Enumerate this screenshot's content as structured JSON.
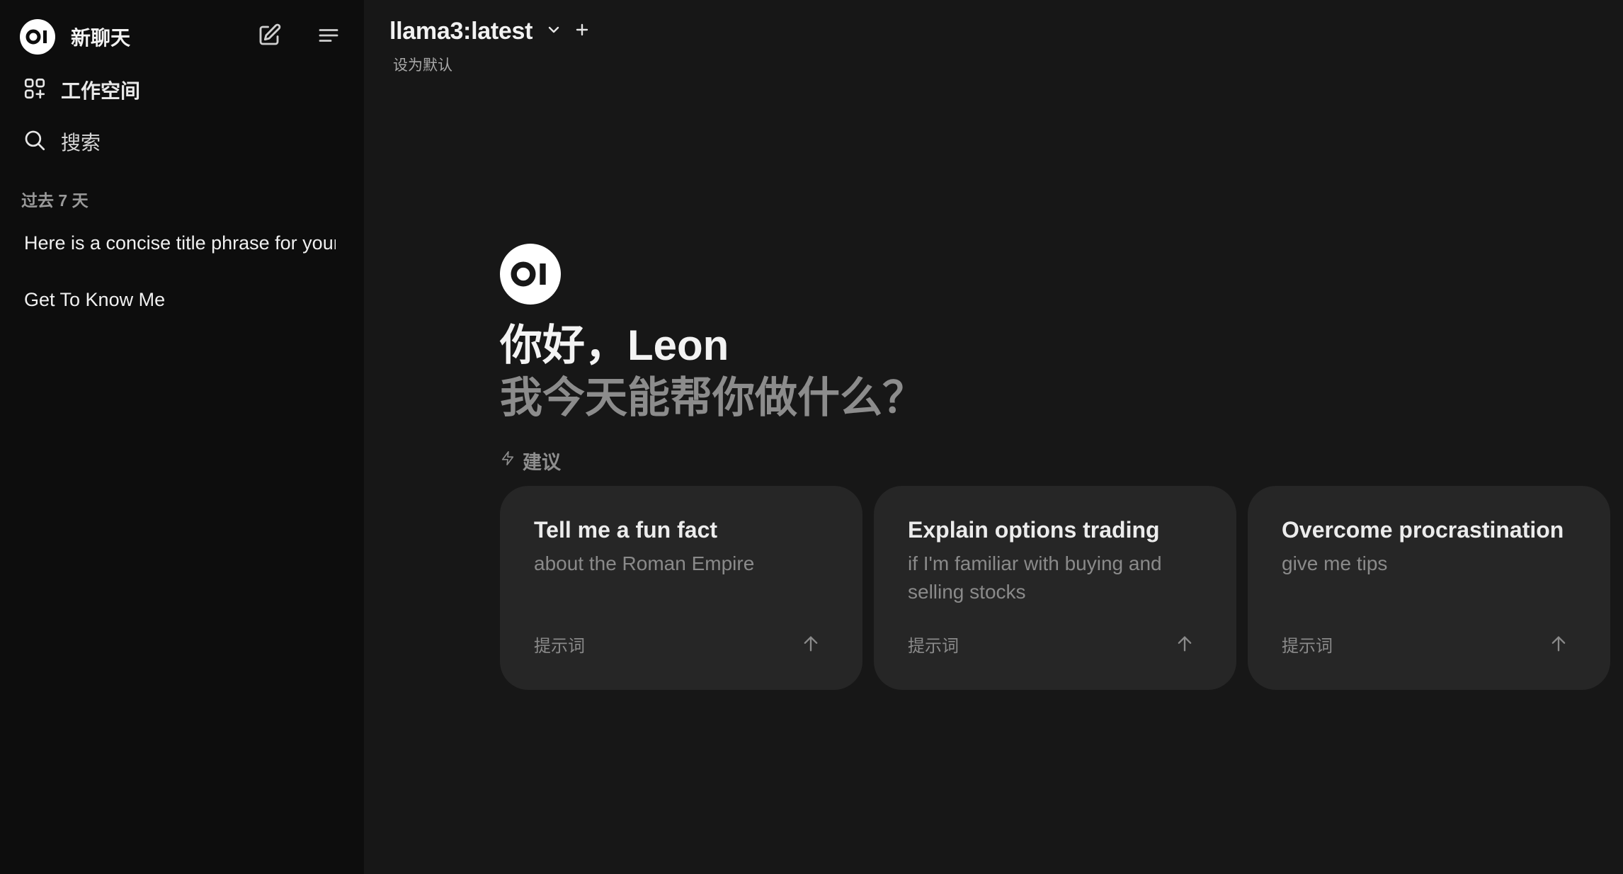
{
  "sidebar": {
    "logo_text": "OI",
    "new_chat_label": "新聊天",
    "workspace_label": "工作空间",
    "search_label": "搜索",
    "section_label": "过去 7 天",
    "chats": [
      {
        "title": "Here is a concise title phrase for your"
      },
      {
        "title": "Get To Know Me"
      }
    ]
  },
  "header": {
    "model_name": "llama3:latest",
    "set_default_label": "设为默认"
  },
  "main": {
    "logo_text": "OI",
    "greeting": "你好，Leon",
    "subheading": "我今天能帮你做什么？",
    "suggestions_label": "建议",
    "cards": [
      {
        "title": "Tell me a fun fact",
        "description": "about the Roman Empire",
        "footer": "提示词"
      },
      {
        "title": "Explain options trading",
        "description": "if I'm familiar with buying and selling stocks",
        "footer": "提示词"
      },
      {
        "title": "Overcome procrastination",
        "description": "give me tips",
        "footer": "提示词"
      }
    ]
  },
  "colors": {
    "background": "#171717",
    "sidebar_background": "#0d0d0d",
    "card_background": "#262626",
    "text_primary": "#ececec",
    "text_muted": "#8a8a8a"
  }
}
